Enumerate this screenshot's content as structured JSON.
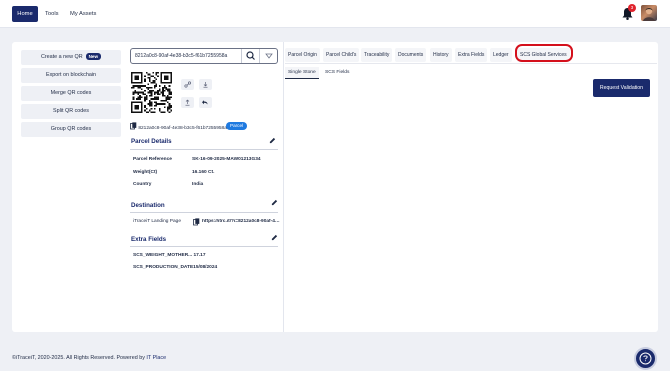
{
  "nav": {
    "items": [
      {
        "label": "Home",
        "active": true
      },
      {
        "label": "Tools"
      },
      {
        "label": "My Assets"
      }
    ],
    "notification_count": "3"
  },
  "sidebar": {
    "create_label": "Create a new QR",
    "new_badge": "New",
    "actions": [
      "Export on blockchain",
      "Merge QR codes",
      "Split QR codes",
      "Group QR codes"
    ]
  },
  "search": {
    "value": "8212a0c8-90af-4e38-b3c5-f61b7255958a"
  },
  "asset": {
    "id": "8212a0c8-90af-4e38-b3c5-f61b7255958a",
    "type_badge": "Parcel"
  },
  "parcel_details": {
    "title": "Parcel Details",
    "rows": [
      {
        "label": "Parcel Reference",
        "value": "SK-16-09-2025-MAW01213G34"
      },
      {
        "label": "Weight(Ct)",
        "value": "16.160 Ct."
      },
      {
        "label": "Country",
        "value": "India"
      }
    ]
  },
  "destination": {
    "title": "Destination",
    "label": "iTraceiT Landing Page",
    "link": "https://itrc.it/?i=8212a0c8-90af-4e38-b3c5-f61b7255958a"
  },
  "extra_fields": {
    "title": "Extra Fields",
    "items": [
      "SCS_WEIGHT_MOTHER... 17.17",
      "SCS_PRODUCTION_DATE15/08/2024"
    ]
  },
  "tabs": [
    "Parcel Origin",
    "Parcel Child's",
    "Traceability",
    "Documents",
    "History",
    "Extra Fields",
    "Ledger",
    "SCS Global Services"
  ],
  "subtabs": [
    "Single Stone",
    "SCS Fields"
  ],
  "request_validation_label": "Request Validation",
  "footer": {
    "text": "©iTraceiT, 2020-2025. All Rights Reserved. Powered by",
    "link": "IT Place"
  },
  "colors": {
    "primary": "#1a2a6c",
    "highlight": "#d4101c",
    "badge_blue": "#1f7ae0"
  }
}
